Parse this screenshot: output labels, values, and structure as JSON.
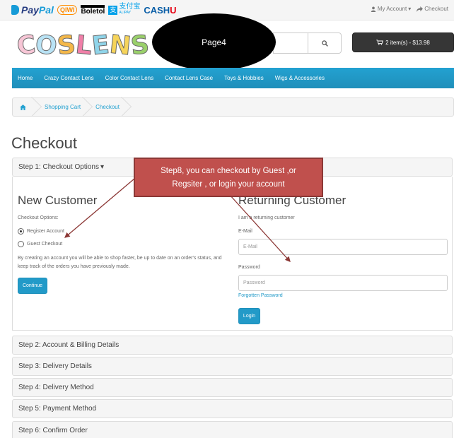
{
  "annotation_bubble": "Page4",
  "payment_logos": {
    "paypal_a": "Pay",
    "paypal_b": "Pal",
    "qiwi": "QIWI",
    "boletol": "Boletol",
    "alipay_cn": "支付宝",
    "alipay_en": "ALIPAY",
    "cashu_a": "CASH",
    "cashu_b": "U"
  },
  "top_links": {
    "my_account": "My Account",
    "checkout": "Checkout"
  },
  "logo_letters": [
    "C",
    "O",
    "S",
    "L",
    "E",
    "N",
    "S"
  ],
  "logo_colors": [
    "#f7c6d6",
    "#b9e3f5",
    "#f4b84a",
    "#f07fa8",
    "#8fd4e9",
    "#f6d45a",
    "#9ad06b"
  ],
  "cart": {
    "label": "2 item(s) - $13.98"
  },
  "nav": [
    "Home",
    "Crazy Contact Lens",
    "Color Contact Lens",
    "Contact Lens Case",
    "Toys & Hobbies",
    "Wigs & Accessories"
  ],
  "breadcrumb": [
    "Shopping Cart",
    "Checkout"
  ],
  "page_title": "Checkout",
  "step1": {
    "heading": "Step 1: Checkout Options",
    "new_customer": {
      "title": "New Customer",
      "options_label": "Checkout Options:",
      "register": "Register Account",
      "guest": "Guest Checkout",
      "selected": "Register Account",
      "description": "By creating an account you will be able to shop faster, be up to date on an order's status, and keep track of the orders you have previously made.",
      "continue": "Continue"
    },
    "returning": {
      "title": "Returning Customer",
      "subtitle": "I am a returning customer",
      "email_label": "E-Mail",
      "email_placeholder": "E-Mail",
      "password_label": "Password",
      "password_placeholder": "Password",
      "forgotten": "Forgotten Password",
      "login": "Login"
    }
  },
  "steps": [
    "Step 2: Account & Billing Details",
    "Step 3: Delivery Details",
    "Step 4: Delivery Method",
    "Step 5: Payment Method",
    "Step 6: Confirm Order"
  ],
  "callout": {
    "line1": "Step8, you can checkout  by Guest ,or",
    "line2": "Regsiter , or login your account"
  },
  "colors": {
    "accent": "#229ac8",
    "callout": "#c0504d",
    "cart_button": "#363636"
  }
}
